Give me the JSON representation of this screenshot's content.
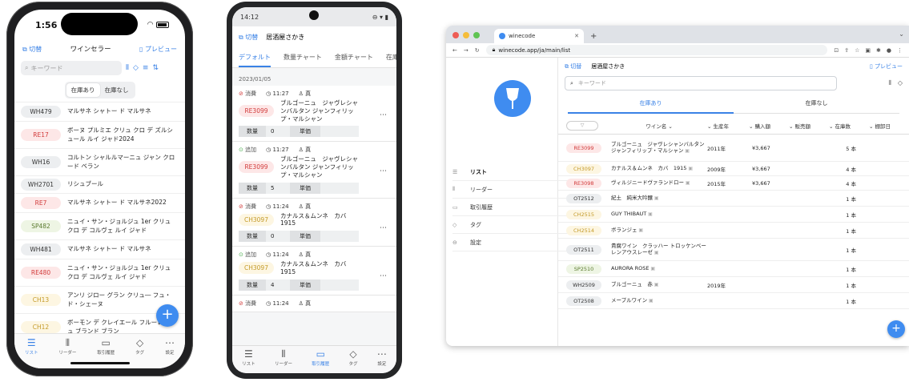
{
  "iphone": {
    "time": "1:56",
    "header": {
      "left": "切替",
      "title": "ワインセラー",
      "right": "プレビュー"
    },
    "search_placeholder": "キーワード",
    "segment": [
      "在庫あり",
      "在庫なし"
    ],
    "rows": [
      {
        "code": "WH479",
        "color": "gray",
        "name": "マルサネ シャトー ド マルサネ"
      },
      {
        "code": "RE17",
        "color": "red",
        "name": "ボーヌ プルミエ クリュ クロ デ ズルシュール ルイ ジャド2024"
      },
      {
        "code": "WH16",
        "color": "gray",
        "name": "コルトン シャルルマーニュ ジャン クロード ベラン"
      },
      {
        "code": "WH2701",
        "color": "gray",
        "name": "リシュブール"
      },
      {
        "code": "RE7",
        "color": "red",
        "name": "マルサネ シャトー ド マルサネ2022"
      },
      {
        "code": "SP482",
        "color": "green",
        "name": "ニュイ・サン・ジョルジュ 1er クリュ クロ デ コルヴェ ルイ ジャド"
      },
      {
        "code": "WH481",
        "color": "gray",
        "name": "マルサネ シャトー ド マルサネ"
      },
      {
        "code": "RE480",
        "color": "red",
        "name": "ニュイ・サン・ジョルジュ 1er クリュ クロ デ コルヴェ ルイ ジャド"
      },
      {
        "code": "CH13",
        "color": "yellow",
        "name": "アンリ ジロー グラン クリュ― フュ・ド・シェーヌ"
      },
      {
        "code": "CH12",
        "color": "yellow",
        "name": "ボーモン デ クレイエール フルーレンシュ ブランド ブラン"
      }
    ],
    "tabs": [
      "リスト",
      "リーダー",
      "取引履歴",
      "タグ",
      "設定"
    ]
  },
  "android": {
    "time": "14:12",
    "header": {
      "left": "切替",
      "title": "居酒屋さかき"
    },
    "tabs": [
      "デフォルト",
      "数量チャート",
      "金額チャート",
      "在庫"
    ],
    "date": "2023/01/05",
    "cards": [
      {
        "status": "消費",
        "time": "11:27",
        "user": "真",
        "code": "RE3099",
        "color": "red",
        "name": "ブルゴーニュ　ジャヴレシャンバルタン ジャンフィリップ・マルシャン",
        "qty": "0"
      },
      {
        "status": "追加",
        "time": "11:27",
        "user": "真",
        "code": "RE3099",
        "color": "red",
        "name": "ブルゴーニュ　ジャヴレシャンバルタン ジャンフィリップ・マルシャン",
        "qty": "5"
      },
      {
        "status": "消費",
        "time": "11:24",
        "user": "真",
        "code": "CH3097",
        "color": "yellow",
        "name": "カナルス＆ムンネ　カバ 1915",
        "qty": "0"
      },
      {
        "status": "追加",
        "time": "11:24",
        "user": "真",
        "code": "CH3097",
        "color": "yellow",
        "name": "カナルス＆ムンネ　カバ 1915",
        "qty": "4"
      },
      {
        "status": "消費",
        "time": "11:24",
        "user": "真"
      }
    ],
    "qty_label": "数量",
    "unit_label": "単価",
    "nav": [
      "リスト",
      "リーダー",
      "取引履歴",
      "タグ",
      "設定"
    ]
  },
  "browser": {
    "tab_title": "winecode",
    "url": "winecode.app/ja/main/list",
    "header": {
      "left": "切替",
      "title": "居酒屋さかき",
      "right": "プレビュー"
    },
    "search_placeholder": "キーワード",
    "segment": [
      "在庫あり",
      "在庫なし"
    ],
    "columns": [
      "ワイン名",
      "生産年",
      "購入額",
      "販売額",
      "在庫数",
      "棚卸日"
    ],
    "sidebar": [
      "リスト",
      "リーダー",
      "取引履歴",
      "タグ",
      "設定"
    ],
    "rows": [
      {
        "code": "RE3099",
        "color": "red",
        "name": "ブルゴーニュ　ジャヴレシャンバルタン ジャンフィリップ・マルシャン",
        "year": "2011年",
        "price": "¥3,667",
        "stock": "5 本"
      },
      {
        "code": "CH3097",
        "color": "yellow",
        "name": "カナルス＆ムンネ　カバ　1915",
        "year": "2009年",
        "price": "¥3,667",
        "stock": "4 本"
      },
      {
        "code": "RE3098",
        "color": "red",
        "name": "ヴィルジニードヴァランドロー",
        "year": "2015年",
        "price": "¥3,667",
        "stock": "4 本"
      },
      {
        "code": "OT2512",
        "color": "gray",
        "name": "紀土　純米大吟醸",
        "year": "",
        "price": "",
        "stock": "1 本"
      },
      {
        "code": "CH2515",
        "color": "yellow",
        "name": "GUY THIBAUT",
        "year": "",
        "price": "",
        "stock": "1 本"
      },
      {
        "code": "CH2514",
        "color": "yellow",
        "name": "ボランジェ",
        "year": "",
        "price": "",
        "stock": "1 本"
      },
      {
        "code": "OT2511",
        "color": "gray",
        "name": "貴腐ワイン　クラッハー トロッケンベーレンアウスレーゼ",
        "year": "",
        "price": "",
        "stock": "1 本"
      },
      {
        "code": "SP2510",
        "color": "green",
        "name": "AURORA ROSE",
        "year": "",
        "price": "",
        "stock": "1 本"
      },
      {
        "code": "WH2509",
        "color": "gray",
        "name": "ブルゴーニュ　赤",
        "year": "2019年",
        "price": "",
        "stock": "1 本"
      },
      {
        "code": "OT2508",
        "color": "gray",
        "name": "メープルワイン",
        "year": "",
        "price": "",
        "stock": "1 本"
      }
    ]
  },
  "colors": {
    "accent": "#3a82e6",
    "fab": "#3f8cf0"
  }
}
